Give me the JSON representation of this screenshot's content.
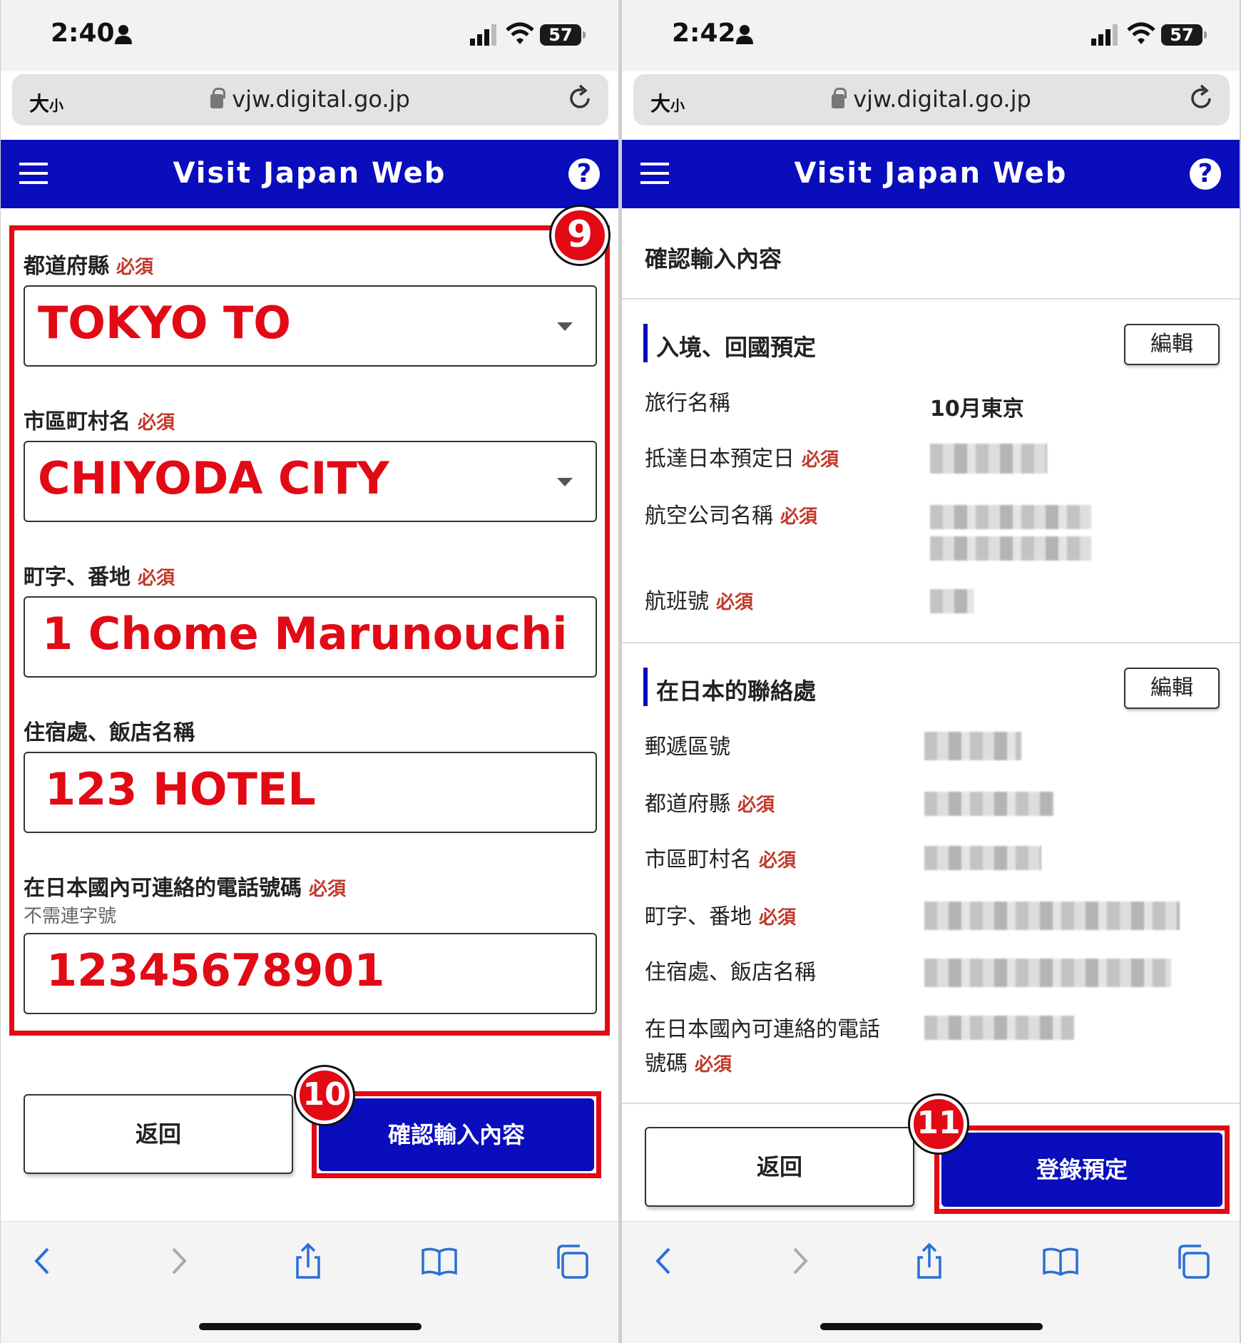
{
  "left": {
    "status": {
      "time": "2:40",
      "battery": "57"
    },
    "browser": {
      "text_size": "大",
      "text_size_small": "小",
      "url": "vjw.digital.go.jp"
    },
    "nav": {
      "title": "Visit Japan Web",
      "help": "?"
    },
    "step_badges": {
      "nine": "9",
      "ten": "10"
    },
    "fields": {
      "prefecture": {
        "label": "都道府縣",
        "required": "必須",
        "value": "TOKYO TO"
      },
      "city": {
        "label": "市區町村名",
        "required": "必須",
        "value": "CHIYODA CITY"
      },
      "street": {
        "label": "町字、番地",
        "required": "必須",
        "value": "1 Chome Marunouchi"
      },
      "hotel": {
        "label": "住宿處、飯店名稱",
        "value": "123 HOTEL"
      },
      "phone": {
        "label": "在日本國內可連絡的電話號碼",
        "required": "必須",
        "hint": "不需連字號",
        "value": "12345678901"
      }
    },
    "buttons": {
      "back": "返回",
      "confirm": "確認輸入內容"
    }
  },
  "right": {
    "status": {
      "time": "2:42",
      "battery": "57"
    },
    "browser": {
      "text_size": "大",
      "text_size_small": "小",
      "url": "vjw.digital.go.jp"
    },
    "nav": {
      "title": "Visit Japan Web",
      "help": "?"
    },
    "page_title": "確認輸入內容",
    "step_badges": {
      "eleven": "11"
    },
    "section_entry": {
      "title": "入境、回國預定",
      "edit": "編輯",
      "rows": {
        "trip_name": {
          "label": "旅行名稱",
          "value": "10月東京"
        },
        "arrival_date": {
          "label": "抵達日本預定日",
          "required": "必須"
        },
        "airline": {
          "label": "航空公司名稱",
          "required": "必須"
        },
        "flight": {
          "label": "航班號",
          "required": "必須"
        }
      }
    },
    "section_contact": {
      "title": "在日本的聯絡處",
      "edit": "編輯",
      "rows": {
        "postal": {
          "label": "郵遞區號"
        },
        "prefecture": {
          "label": "都道府縣",
          "required": "必須"
        },
        "city": {
          "label": "市區町村名",
          "required": "必須"
        },
        "street": {
          "label": "町字、番地",
          "required": "必須"
        },
        "hotel": {
          "label": "住宿處、飯店名稱"
        },
        "phone": {
          "label_line1": "在日本國內可連絡的電話",
          "label_line2": "號碼",
          "required": "必須"
        }
      }
    },
    "buttons": {
      "back": "返回",
      "register": "登錄預定"
    }
  },
  "colors": {
    "brand_blue": "#0a0dbc",
    "highlight_red": "#e10a15",
    "required_red": "#c0392b"
  },
  "icons": [
    "person-icon",
    "signal-icon",
    "wifi-icon",
    "battery-icon",
    "lock-icon",
    "reload-icon",
    "hamburger-menu-icon",
    "help-icon",
    "back-arrow-icon",
    "forward-arrow-icon",
    "share-icon",
    "bookmarks-icon",
    "tabs-icon"
  ]
}
